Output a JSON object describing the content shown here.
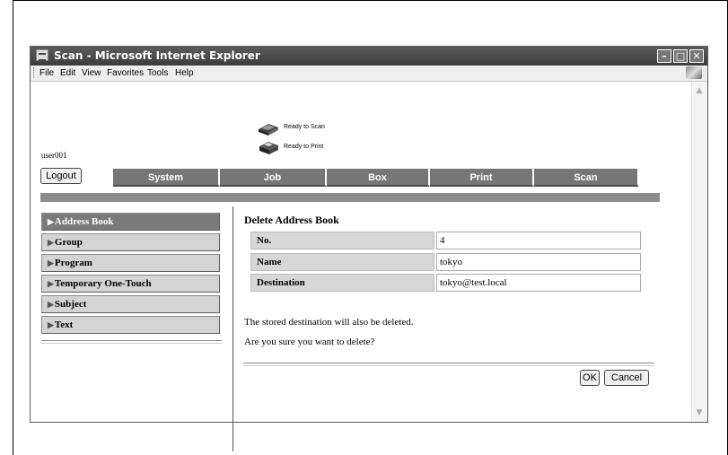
{
  "window": {
    "title": "Scan - Microsoft Internet Explorer",
    "minimize": "–",
    "maximize": "□",
    "close": "✕"
  },
  "menu": [
    {
      "label": "File"
    },
    {
      "label": "Edit"
    },
    {
      "label": "View"
    },
    {
      "label": "Favorites"
    },
    {
      "label": "Tools"
    },
    {
      "label": "Help"
    }
  ],
  "status": {
    "scan": "Ready to Scan",
    "print": "Ready to Print"
  },
  "user": {
    "name": "user001",
    "logout_label": "Logout"
  },
  "tabs": [
    {
      "label": "System"
    },
    {
      "label": "Job"
    },
    {
      "label": "Box"
    },
    {
      "label": "Print"
    },
    {
      "label": "Scan"
    }
  ],
  "sidebar": {
    "items": [
      {
        "label": "Address Book",
        "active": true
      },
      {
        "label": "Group"
      },
      {
        "label": "Program"
      },
      {
        "label": "Temporary One-Touch"
      },
      {
        "label": "Subject"
      },
      {
        "label": "Text"
      }
    ]
  },
  "panel": {
    "title": "Delete Address Book",
    "rows": [
      {
        "label": "No.",
        "value": "4"
      },
      {
        "label": "Name",
        "value": "tokyo"
      },
      {
        "label": "Destination",
        "value": "tokyo@test.local"
      }
    ],
    "message1": "The stored destination will also be deleted.",
    "message2": "Are you sure you want to delete?",
    "ok_label": "OK",
    "cancel_label": "Cancel"
  },
  "icons": {
    "scan_status": "scanner-icon",
    "print_status": "printer-icon",
    "app": "ie-icon",
    "throbber": "windows-logo-icon"
  }
}
